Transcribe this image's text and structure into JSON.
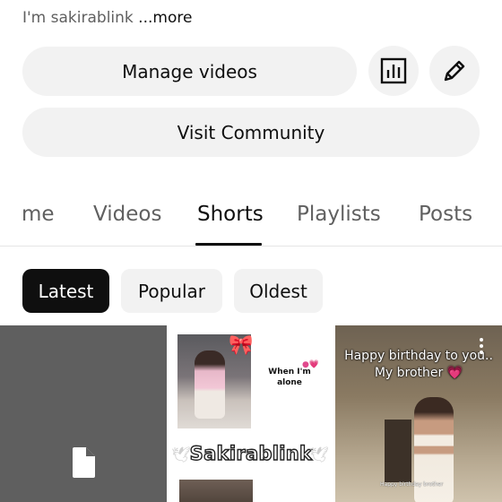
{
  "channel": {
    "description": "I'm sakirablink",
    "more_label": "...more"
  },
  "actions": {
    "manage_videos": "Manage videos",
    "visit_community": "Visit Community",
    "analytics_icon": "bar-chart-icon",
    "edit_icon": "pencil-icon"
  },
  "tabs": [
    {
      "label": "Home",
      "visible_text": "me",
      "active": false
    },
    {
      "label": "Videos",
      "active": false
    },
    {
      "label": "Shorts",
      "active": true
    },
    {
      "label": "Playlists",
      "active": false
    },
    {
      "label": "Posts",
      "active": false
    }
  ],
  "filters": [
    {
      "label": "Latest",
      "selected": true
    },
    {
      "label": "Popular",
      "selected": false
    },
    {
      "label": "Oldest",
      "selected": false
    }
  ],
  "shorts": [
    {
      "thumbnail": "placeholder",
      "icon": "document-icon"
    },
    {
      "overlay_caption": "When I'm alone",
      "overlay_title": "Sakirablink"
    },
    {
      "overlay_caption_line1": "Happy birthday to you..",
      "overlay_caption_line2": "My brother",
      "heart": "💗",
      "menu_icon": "more-vert-icon"
    }
  ],
  "colors": {
    "chip_selected_bg": "#0f0f0f",
    "chip_bg": "#f2f2f2",
    "text_primary": "#0f0f0f",
    "text_secondary": "#606060"
  }
}
